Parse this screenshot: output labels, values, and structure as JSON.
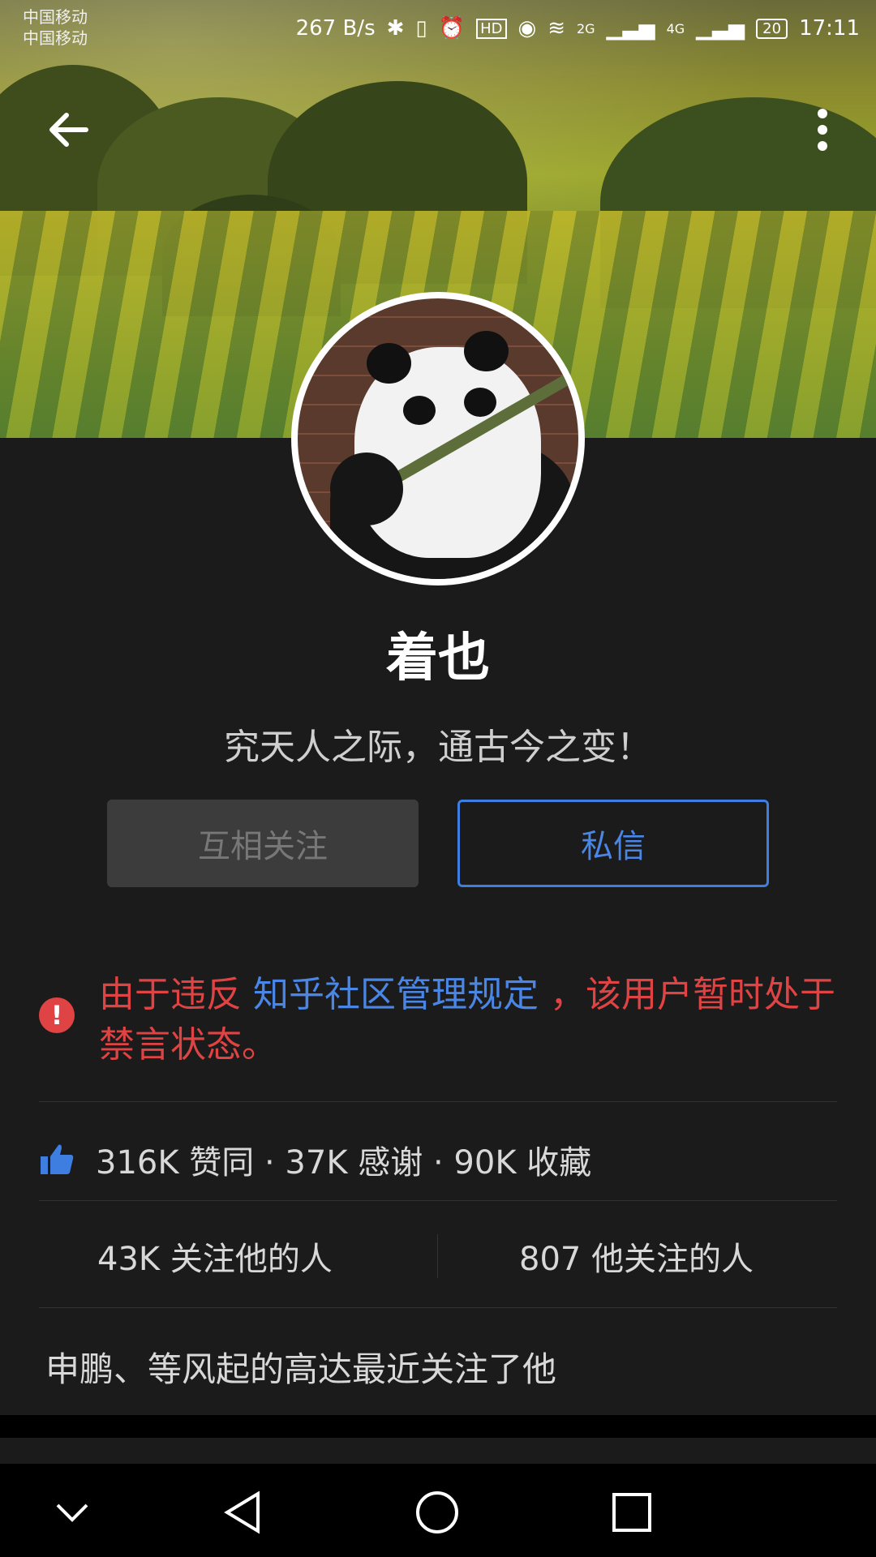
{
  "status_bar": {
    "carrier_1": "中国移动",
    "carrier_2": "中国移动",
    "net_speed": "267 B/s",
    "signal_2g": "2G",
    "signal_4g": "4G",
    "battery": "20",
    "time": "17:11"
  },
  "header": {
    "back_icon": "arrow-left-icon",
    "more_icon": "more-vert-icon"
  },
  "profile": {
    "name": "着也",
    "bio": "究天人之际，通古今之变！"
  },
  "actions": {
    "follow_label": "互相关注",
    "message_label": "私信"
  },
  "ban_notice": {
    "prefix": "由于违反 ",
    "link": "知乎社区管理规定",
    "suffix": " ，该用户暂时处于禁言状态。"
  },
  "stats": {
    "text": "316K 赞同 · 37K 感谢 · 90K 收藏"
  },
  "follow": {
    "followers": "43K 关注他的人",
    "following": "807 他关注的人"
  },
  "recent": {
    "text": "申鹏、等风起的高达最近关注了他"
  },
  "colors": {
    "accent_blue": "#4a86e6",
    "warning_red": "#e04343",
    "background": "#1b1b1b"
  }
}
